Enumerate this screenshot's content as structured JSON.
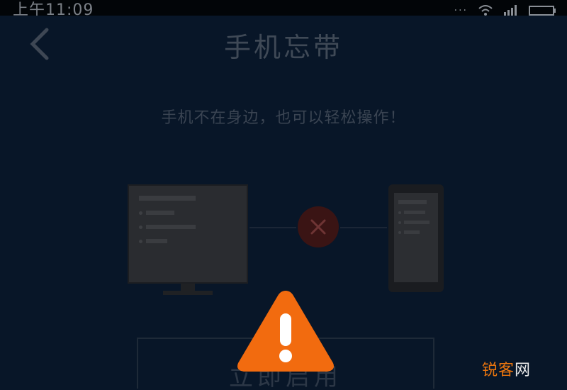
{
  "status_bar": {
    "time": "上午11:09"
  },
  "header": {
    "title": "手机忘带"
  },
  "main": {
    "subtitle": "手机不在身边，也可以轻松操作！",
    "enable_button_label": "立即启用"
  },
  "overlay": {
    "icon": "warning-icon",
    "color": "#f26b0f"
  },
  "watermark": {
    "part1": "锐客",
    "part2": "网"
  },
  "colors": {
    "background": "#081628",
    "status_bar": "#020508",
    "warning": "#f26b0f",
    "error_circle": "#3a1414"
  }
}
